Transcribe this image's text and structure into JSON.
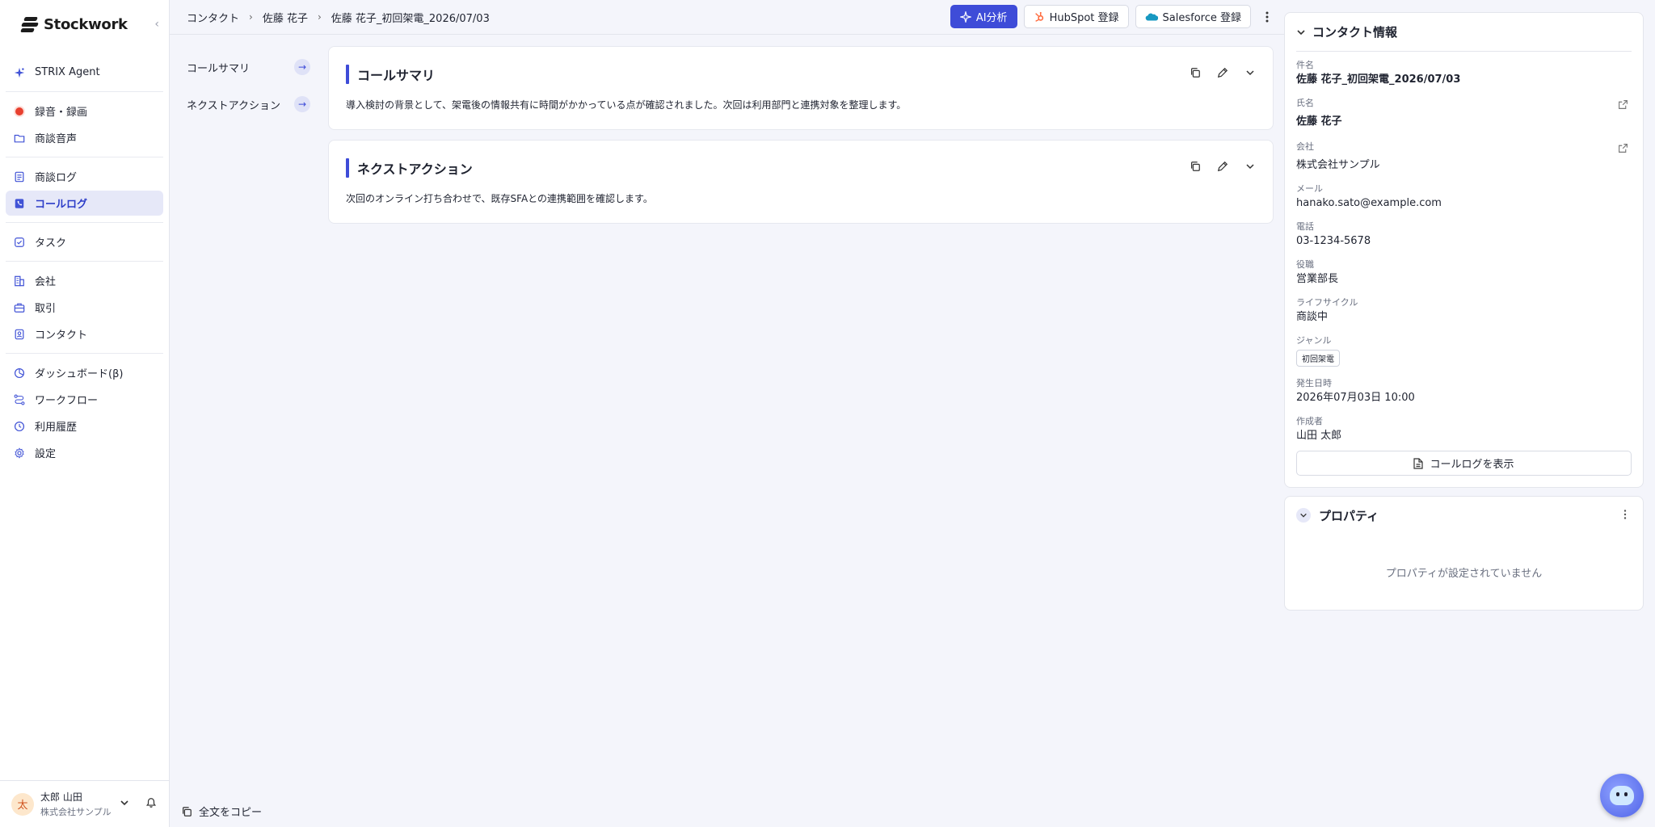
{
  "brand": {
    "name": "Stockwork"
  },
  "sidebar": {
    "groups": [
      [
        {
          "label": "STRIX Agent",
          "icon": "sparkle-icon"
        }
      ],
      [
        {
          "label": "録音・録画",
          "icon": "record-icon"
        },
        {
          "label": "商談音声",
          "icon": "folder-icon"
        }
      ],
      [
        {
          "label": "商談ログ",
          "icon": "document-icon"
        },
        {
          "label": "コールログ",
          "icon": "call-log-icon",
          "active": true
        }
      ],
      [
        {
          "label": "タスク",
          "icon": "checkbox-icon"
        }
      ],
      [
        {
          "label": "会社",
          "icon": "building-icon"
        },
        {
          "label": "取引",
          "icon": "briefcase-icon"
        },
        {
          "label": "コンタクト",
          "icon": "contact-icon"
        }
      ],
      [
        {
          "label": "ダッシュボード(β)",
          "icon": "dashboard-icon"
        },
        {
          "label": "ワークフロー",
          "icon": "workflow-icon"
        },
        {
          "label": "利用履歴",
          "icon": "clock-icon"
        },
        {
          "label": "設定",
          "icon": "gear-icon"
        }
      ]
    ],
    "user": {
      "avatar_initial": "太",
      "name": "太郎 山田",
      "company": "株式会社サンプル"
    }
  },
  "breadcrumb": [
    "コンタクト",
    "佐藤 花子",
    "佐藤 花子_初回架電_2026/07/03"
  ],
  "toolbar": {
    "ai_label": "AI分析",
    "hubspot_label": "HubSpot 登録",
    "salesforce_label": "Salesforce 登録"
  },
  "section_nav": [
    "コールサマリ",
    "ネクストアクション"
  ],
  "cards": [
    {
      "title": "コールサマリ",
      "body": "導入検討の背景として、架電後の情報共有に時間がかかっている点が確認されました。次回は利用部門と連携対象を整理します。"
    },
    {
      "title": "ネクストアクション",
      "body": "次回のオンライン打ち合わせで、既存SFAとの連携範囲を確認します。"
    }
  ],
  "copy_all_label": "全文をコピー",
  "contact_panel": {
    "title": "コンタクト情報",
    "fields": {
      "subject": {
        "label": "件名",
        "value": "佐藤 花子_初回架電_2026/07/03"
      },
      "name": {
        "label": "氏名",
        "value": "佐藤 花子"
      },
      "company": {
        "label": "会社",
        "value": "株式会社サンプル"
      },
      "email": {
        "label": "メール",
        "value": "hanako.sato@example.com"
      },
      "phone": {
        "label": "電話",
        "value": "03-1234-5678"
      },
      "role": {
        "label": "役職",
        "value": "営業部長"
      },
      "lifecycle": {
        "label": "ライフサイクル",
        "value": "商談中"
      },
      "genre": {
        "label": "ジャンル",
        "value": "初回架電"
      },
      "datetime": {
        "label": "発生日時",
        "value": "2026年07月03日 10:00"
      },
      "author": {
        "label": "作成者",
        "value": "山田 太郎"
      }
    },
    "show_log_label": "コールログを表示"
  },
  "property_panel": {
    "title": "プロパティ",
    "empty_text": "プロパティが設定されていません"
  },
  "colors": {
    "accent": "#3e4cd8",
    "background": "#f4f5fb",
    "record": "#e8402f",
    "active_nav_bg": "#e6e8f8"
  }
}
